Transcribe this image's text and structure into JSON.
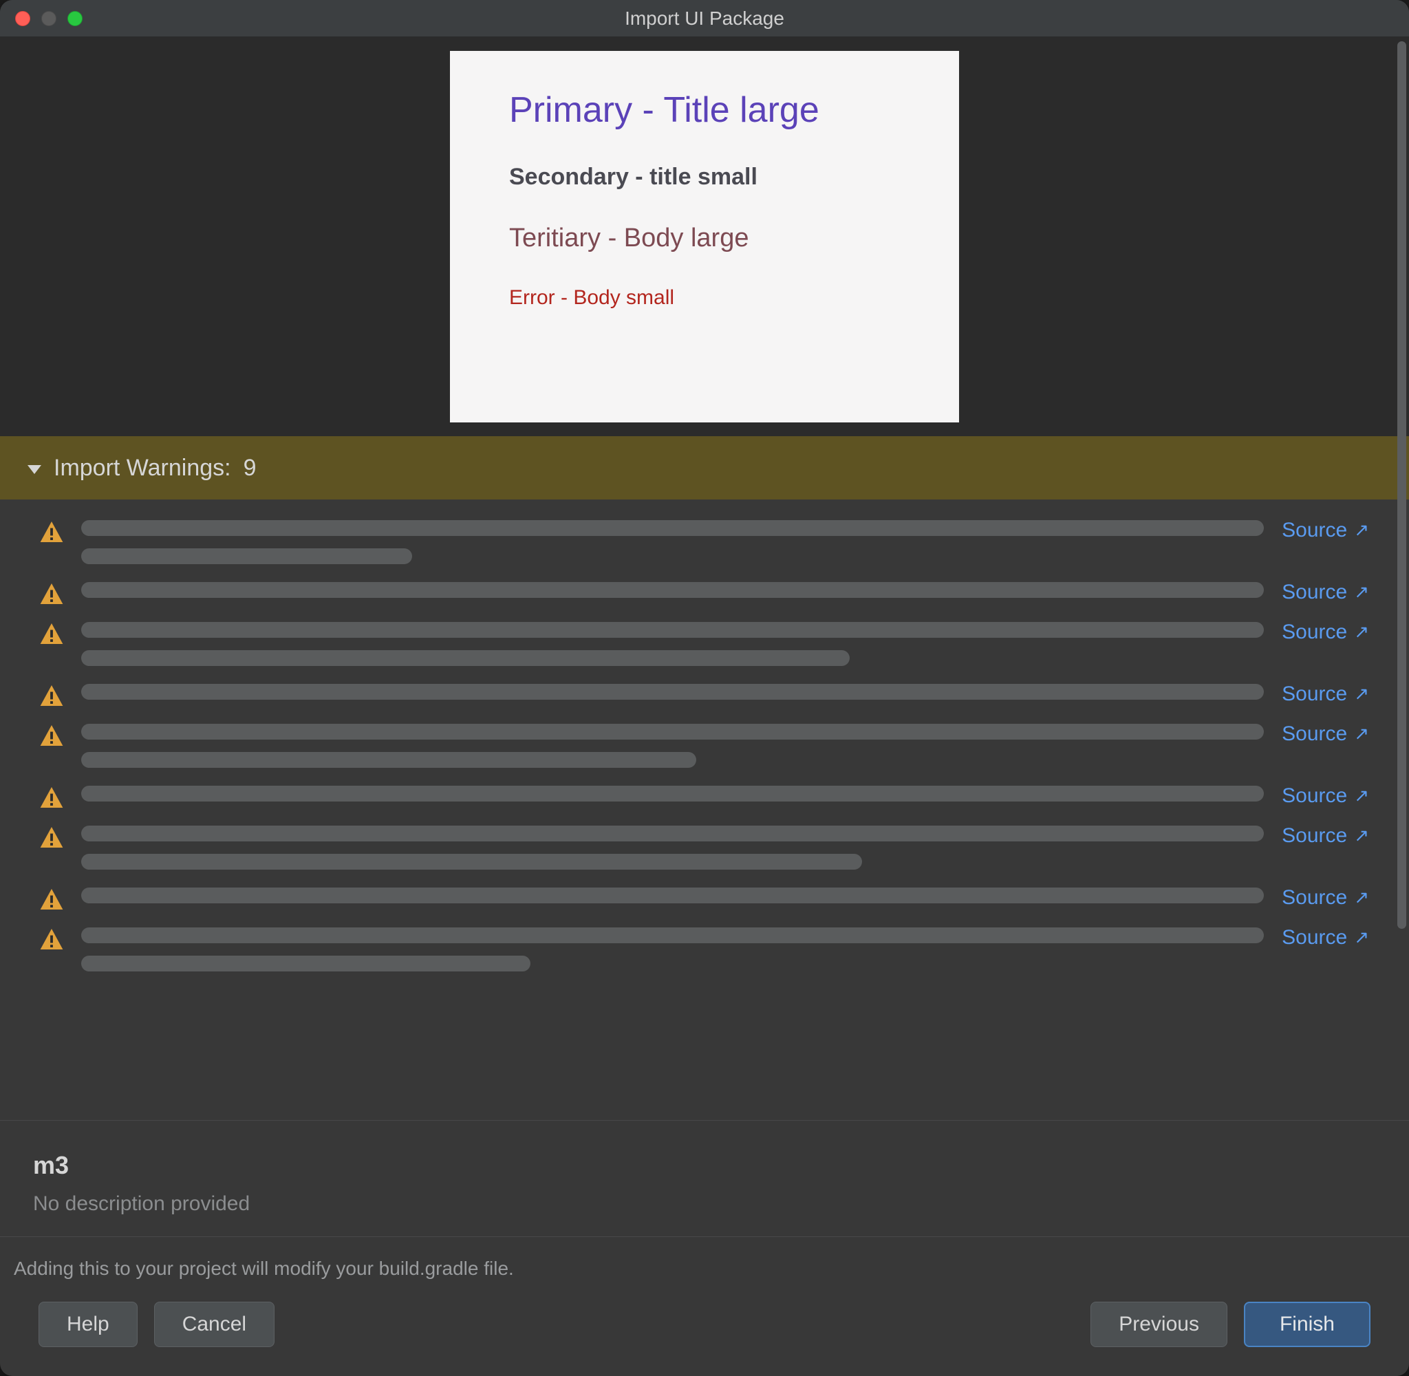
{
  "window": {
    "title": "Import UI Package"
  },
  "preview": {
    "primary": "Primary - Title large",
    "secondary": "Secondary - title small",
    "tertiary": "Teritiary - Body large",
    "error": "Error - Body small"
  },
  "warnings": {
    "header_label": "Import Warnings:",
    "count": "9",
    "source_label": "Source",
    "items": [
      {
        "line2_width_pct": 28,
        "has_line2": true
      },
      {
        "has_line2": false
      },
      {
        "line2_width_pct": 65,
        "has_line2": true
      },
      {
        "has_line2": false
      },
      {
        "line2_width_pct": 52,
        "has_line2": true
      },
      {
        "has_line2": false
      },
      {
        "line2_width_pct": 66,
        "has_line2": true
      },
      {
        "has_line2": false
      },
      {
        "line2_width_pct": 38,
        "has_line2": true
      }
    ]
  },
  "package": {
    "name": "m3",
    "description": "No description provided"
  },
  "footer": {
    "build_note": "Adding this to your project will modify your build.gradle file.",
    "help": "Help",
    "cancel": "Cancel",
    "previous": "Previous",
    "finish": "Finish"
  },
  "colors": {
    "link_blue": "#5a9bf0",
    "warn_header_bg": "#5e5322",
    "btn_primary_bg": "#365880"
  }
}
